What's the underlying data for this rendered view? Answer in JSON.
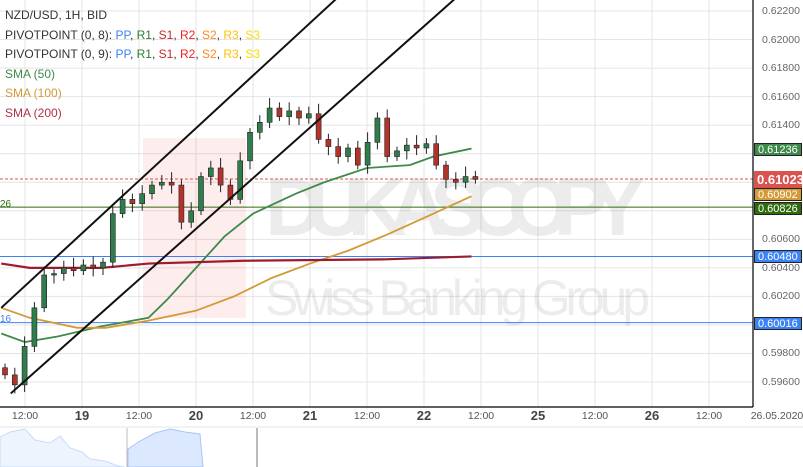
{
  "legend": {
    "title": "NZD/USD, 1H, BID",
    "pivot1_prefix": "PIVOTPOINT (0, 8):",
    "pivot2_prefix": "PIVOTPOINT (0, 9):",
    "pivot_items": [
      {
        "label": "PP",
        "color": "#3b82f6"
      },
      {
        "label": "R1",
        "color": "#2e7d32"
      },
      {
        "label": "S1",
        "color": "#c62828"
      },
      {
        "label": "R2",
        "color": "#ef2020"
      },
      {
        "label": "S2",
        "color": "#ff8a1c"
      },
      {
        "label": "R3",
        "color": "#ffc107"
      },
      {
        "label": "S3",
        "color": "#f5e000"
      }
    ],
    "sma50": "SMA (50)",
    "sma100": "SMA (100)",
    "sma200": "SMA (200)"
  },
  "colors": {
    "sma50": "#3f8a4a",
    "sma100": "#d39a36",
    "sma200": "#9b1c2e",
    "up": "#2f7d4c",
    "down": "#b3332b",
    "current": "#d9534f",
    "pivot_green": "#2e6b0e",
    "pivot_blue": "#3b82f6"
  },
  "watermark": {
    "brand": "DUKASCOPY",
    "tagline": "Swiss Banking Group"
  },
  "level_labels": {
    "green": "26",
    "blue": "16"
  },
  "chart_data": {
    "type": "candlestick",
    "title": "NZD/USD, 1H, BID",
    "ylim": [
      0.5945,
      0.623
    ],
    "y_ticks": [
      "0.62200",
      "0.62000",
      "0.61800",
      "0.61600",
      "0.61400",
      "0.60600",
      "0.60400",
      "0.60200",
      "0.59800",
      "0.59600"
    ],
    "y_tick_values": [
      0.622,
      0.62,
      0.618,
      0.616,
      0.614,
      0.606,
      0.604,
      0.602,
      0.598,
      0.596
    ],
    "x_ticks": [
      {
        "label": "12:00",
        "day": false,
        "t": 0
      },
      {
        "label": "19",
        "day": true,
        "t": 12
      },
      {
        "label": "12:00",
        "day": false,
        "t": 24
      },
      {
        "label": "20",
        "day": true,
        "t": 36
      },
      {
        "label": "12:00",
        "day": false,
        "t": 48
      },
      {
        "label": "21",
        "day": true,
        "t": 60
      },
      {
        "label": "12:00",
        "day": false,
        "t": 72
      },
      {
        "label": "22",
        "day": true,
        "t": 84
      },
      {
        "label": "12:00",
        "day": false,
        "t": 96
      },
      {
        "label": "25",
        "day": true,
        "t": 108
      },
      {
        "label": "12:00",
        "day": false,
        "t": 120
      },
      {
        "label": "26",
        "day": true,
        "t": 132
      },
      {
        "label": "12:00",
        "day": false,
        "t": 144
      },
      {
        "label": "26.05.2020",
        "day": false,
        "t": 158
      }
    ],
    "candle_closes": [
      0.5965,
      0.5958,
      0.5985,
      0.6012,
      0.6035,
      0.6036,
      0.604,
      0.6038,
      0.6042,
      0.604,
      0.6044,
      0.6078,
      0.6088,
      0.6085,
      0.6092,
      0.6098,
      0.61,
      0.6098,
      0.6072,
      0.608,
      0.6104,
      0.611,
      0.6098,
      0.6088,
      0.6115,
      0.6135,
      0.6142,
      0.6152,
      0.6146,
      0.615,
      0.6145,
      0.6148,
      0.613,
      0.6125,
      0.6118,
      0.6124,
      0.6112,
      0.6128,
      0.6145,
      0.6118,
      0.6122,
      0.6126,
      0.6124,
      0.6127,
      0.6112,
      0.6102,
      0.61,
      0.6104,
      0.6102
    ],
    "candle_first_open": 0.597,
    "series": [
      {
        "name": "SMA (50)",
        "t": [
          -5,
          0,
          7,
          16,
          26,
          30,
          36,
          42,
          48,
          57,
          63,
          72,
          81,
          86,
          94
        ],
        "values": [
          0.5994,
          0.5988,
          0.5992,
          0.5999,
          0.6005,
          0.6018,
          0.604,
          0.6062,
          0.6078,
          0.6092,
          0.61,
          0.611,
          0.6112,
          0.6118,
          0.61236
        ]
      },
      {
        "name": "SMA (100)",
        "t": [
          -5,
          1,
          11,
          17,
          26,
          36,
          44,
          52,
          60,
          68,
          76,
          84,
          94
        ],
        "values": [
          0.6012,
          0.6005,
          0.5998,
          0.5998,
          0.6003,
          0.601,
          0.602,
          0.6033,
          0.6043,
          0.6052,
          0.6063,
          0.6075,
          0.60902
        ]
      },
      {
        "name": "SMA (200)",
        "t": [
          -5,
          1,
          16,
          26,
          46,
          76,
          94
        ],
        "values": [
          0.6043,
          0.604,
          0.604,
          0.6043,
          0.6045,
          0.6046,
          0.6048
        ]
      }
    ],
    "channel_lines": [
      {
        "t": [
          -5,
          66
        ],
        "values": [
          0.6012,
          0.623
        ]
      },
      {
        "t": [
          -3,
          91
        ],
        "values": [
          0.5952,
          0.623
        ]
      }
    ],
    "levels": [
      {
        "name": "current",
        "value": 0.61023,
        "label": "0.61023"
      },
      {
        "name": "sma50",
        "value": 0.61236,
        "label": "0.61236"
      },
      {
        "name": "sma100",
        "value": 0.60902,
        "label": "0.60902"
      },
      {
        "name": "pivot-green",
        "value": 0.60826,
        "label": "0.60826"
      },
      {
        "name": "pivot-blue-1",
        "value": 0.6048,
        "label": "0.60480"
      },
      {
        "name": "pivot-blue-2",
        "value": 0.60016,
        "label": "0.60016"
      }
    ]
  }
}
